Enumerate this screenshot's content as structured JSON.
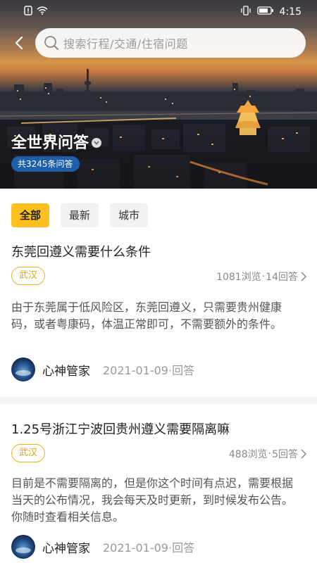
{
  "status_bar": {
    "time": "4:15",
    "icons": [
      "sim-alert-icon",
      "wifi-icon",
      "vibrate-icon",
      "battery-icon"
    ]
  },
  "header": {
    "search_placeholder": "搜索行程/交通/住宿问题",
    "title": "全世界问答",
    "count_badge": "共3245条问答"
  },
  "tabs": [
    {
      "label": "全部",
      "active": true
    },
    {
      "label": "最新",
      "active": false
    },
    {
      "label": "城市",
      "active": false
    }
  ],
  "questions": [
    {
      "title": "东莞回遵义需要什么条件",
      "city": "武汉",
      "views": "1081浏览",
      "separator": "·",
      "answers": "14回答",
      "body": "由于东莞属于低风险区，东莞回遵义，只需要贵州健康码，或者粤康码，体温正常即可，不需要额外的条件。",
      "answerer": "心神管家",
      "date": "2021-01-09·回答"
    },
    {
      "title": "1.25号浙江宁波回贵州遵义需要隔离嘛",
      "city": "武汉",
      "views": "488浏览",
      "separator": "·",
      "answers": "5回答",
      "body": "目前是不需要隔离的，但是你这个时间有点迟，需要根据当天的公布情况，我会每天及时更新，到时候发布公告。你随时查看相关信息。",
      "answerer": "心神管家",
      "date": "2021-01-09·回答"
    }
  ],
  "colors": {
    "accent": "#ffbf1e",
    "tag_border": "#f2b319",
    "badge_bg": "#1f5fa8"
  }
}
